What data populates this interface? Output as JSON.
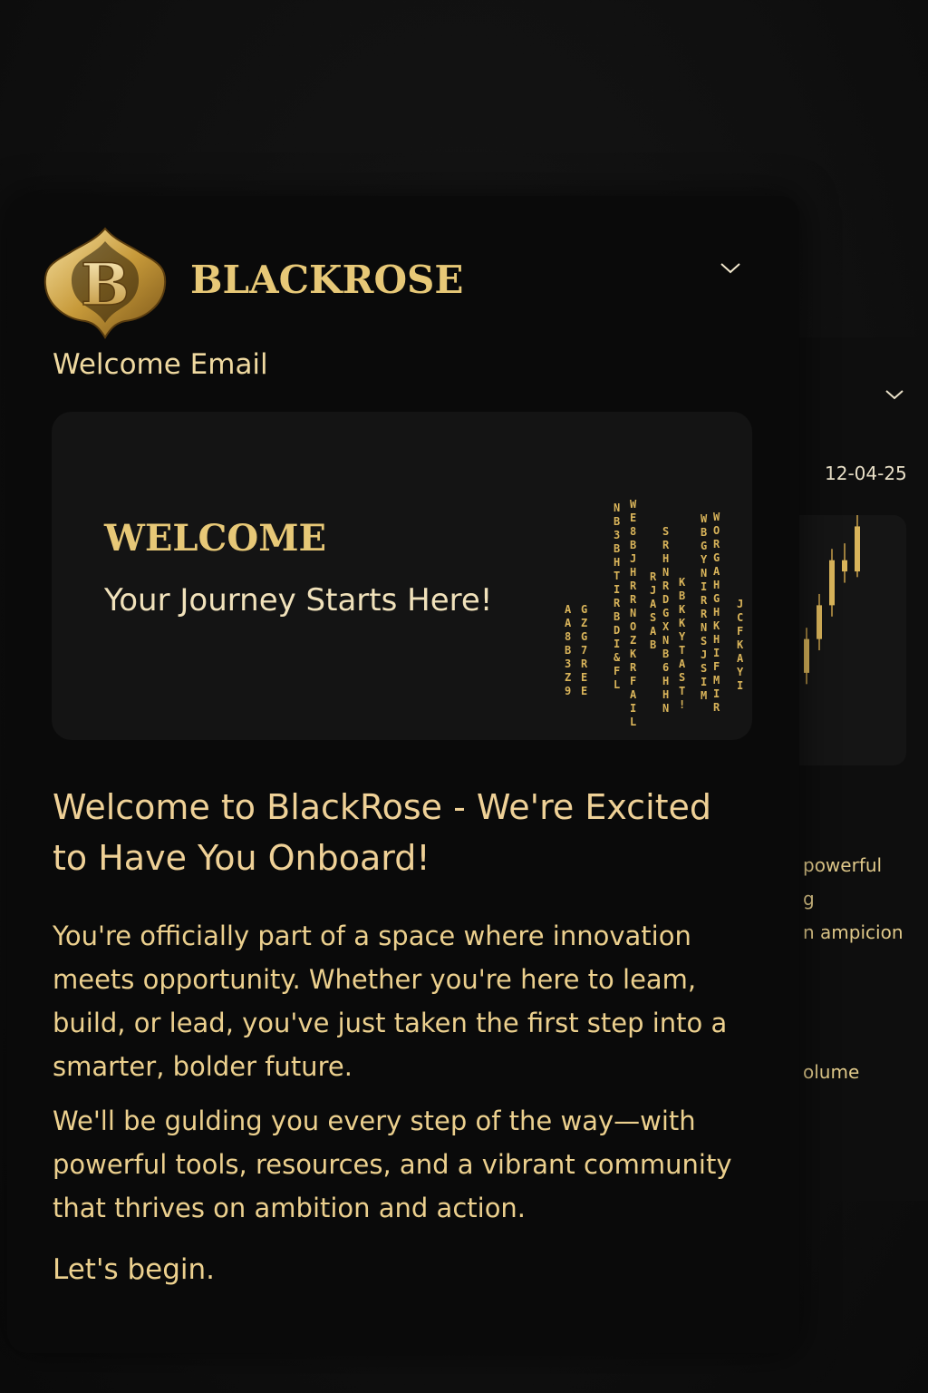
{
  "brand": {
    "name": "BLACKROSE",
    "logo_letter": "B"
  },
  "header": {
    "subtitle": "Welcome Email",
    "toggle_icon": "chevron-down-icon"
  },
  "hero": {
    "title": "WELCOME",
    "subtitle": "Your Journey Starts Here!",
    "art_columns": [
      "AA8B3Z9",
      "GZG7REE",
      "NB3BHTIRBDI&FL",
      "WE8BJHRRNOZKRFAIL",
      "RJASAB",
      "SRHNRDGXNB6HHN",
      "KBKKYTAST!",
      "WBGYNIRRNSJSIM",
      "WORGAHGHKHIFMIR",
      "JCFKAYI"
    ]
  },
  "headline": "Welcome to BlackRose - We're Excited to Have You Onboard!",
  "body": {
    "p1": "You're officially part of a space where innovation meets opportunity. Whether you're here to leam, build, or lead, you've just taken the first step into a smarter, bolder future.",
    "p2": "We'll be gulding you every step of the way—with powerful tools, resources, and a vibrant community that thrives on ambition and action.",
    "closing": "Let's begin."
  },
  "background_card": {
    "date": "12-04-25",
    "fragment_1": "powerful",
    "fragment_2": "g",
    "fragment_3": "n ampicion",
    "fragment_4": "olume",
    "toggle_icon": "chevron-down-icon",
    "chart_candles": [
      {
        "open": 40,
        "close": 46,
        "high": 48,
        "low": 38
      },
      {
        "open": 46,
        "close": 52,
        "high": 54,
        "low": 44
      },
      {
        "open": 52,
        "close": 60,
        "high": 62,
        "low": 50
      },
      {
        "open": 60,
        "close": 58,
        "high": 63,
        "low": 56
      },
      {
        "open": 58,
        "close": 66,
        "high": 68,
        "low": 57
      }
    ]
  },
  "colors": {
    "gold": "#e7c877",
    "text_gold": "#ecd08e",
    "card_bg": "#0a0a0a",
    "hero_bg": "#141414"
  }
}
